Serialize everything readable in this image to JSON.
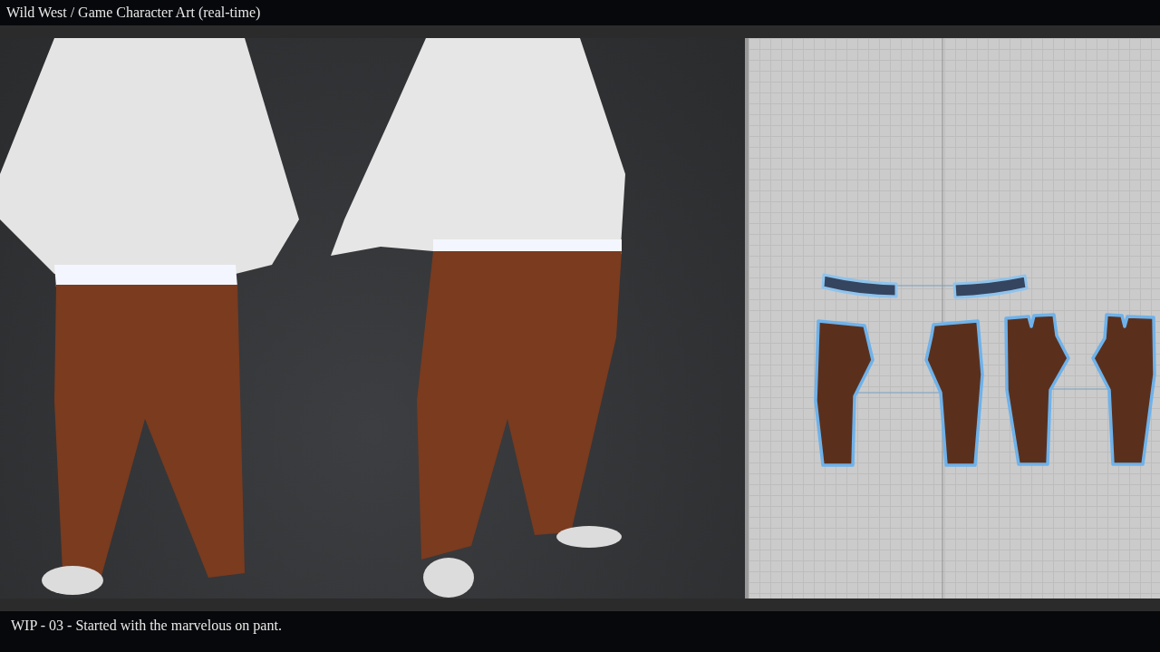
{
  "header": {
    "title": "Wild West / Game Character Art (real-time)"
  },
  "caption": {
    "text": "WIP - 03 - Started with the marvelous on pant."
  }
}
